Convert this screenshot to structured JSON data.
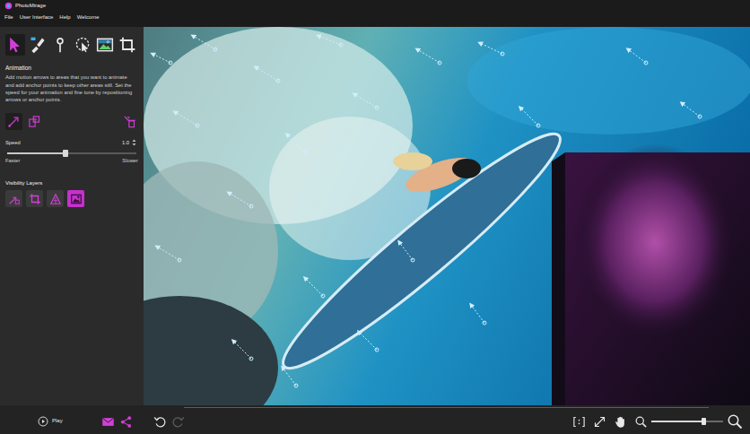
{
  "window": {
    "title": "PhotoMirage"
  },
  "menu": [
    {
      "label": "File"
    },
    {
      "label": "User Interface"
    },
    {
      "label": "Help"
    },
    {
      "label": "Welcome"
    }
  ],
  "tools": [
    {
      "selected": true
    },
    {
      "selected": false
    },
    {
      "selected": false
    },
    {
      "selected": false
    },
    {
      "selected": false
    },
    {
      "selected": false
    }
  ],
  "panel": {
    "title": "Animation",
    "description": "Add motion arrows to areas that you want to animate and add anchor points to keep other areas still. Set the speed for your animation and fine tune by repositioning arrows or anchor points.",
    "actions": [
      {
        "selected": true
      },
      {
        "selected": false
      }
    ],
    "speed": {
      "label": "Speed",
      "value": "1.0",
      "level": 0.45,
      "min_label": "Faster",
      "max_label": "Slower"
    },
    "layers": {
      "title": "Visibility Layers",
      "items": [
        {
          "on": false
        },
        {
          "on": false
        },
        {
          "on": false
        },
        {
          "on": true
        }
      ]
    }
  },
  "player": {
    "play_label": "Play",
    "redo_disabled": true,
    "zoom": {
      "level": 0.72
    }
  }
}
